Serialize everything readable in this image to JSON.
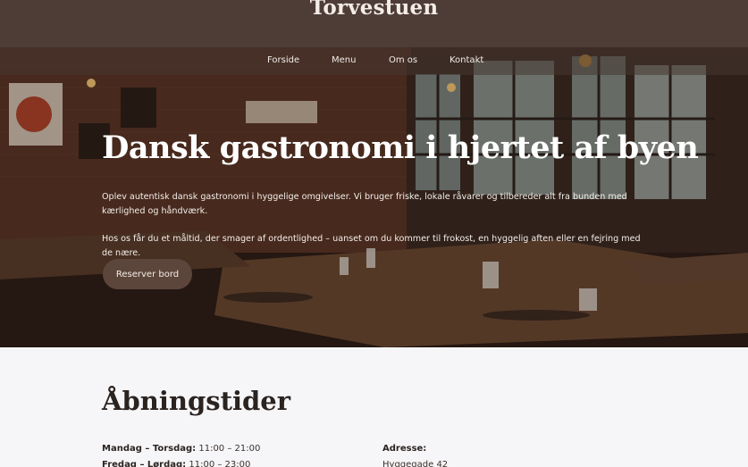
{
  "header": {
    "brand": "Torvestuen"
  },
  "nav": {
    "items": [
      "Forside",
      "Menu",
      "Om os",
      "Kontakt"
    ]
  },
  "hero": {
    "title": "Dansk gastronomi i hjertet af byen",
    "paragraph1": "Oplev autentisk dansk gastronomi i hyggelige omgivelser. Vi bruger friske, lokale råvarer og tilbereder alt fra bunden med kærlighed og håndværk.",
    "paragraph2": "Hos os får du et måltid, der smager af ordentlighed – uanset om du kommer til frokost, en hyggelig aften eller en fejring med de nære.",
    "cta_label": "Reserver bord"
  },
  "hours": {
    "title": "Åbningstider",
    "rows": [
      {
        "days": "Mandag – Torsdag:",
        "time": "11:00 – 21:00"
      },
      {
        "days": "Fredag – Lørdag:",
        "time": "11:00 – 23:00"
      }
    ]
  },
  "address": {
    "label": "Adresse:",
    "street": "Hyggegade 42"
  },
  "colors": {
    "header_bg": "#4d3d36",
    "button_bg": "#5c463b",
    "page_bg": "#f6f6f8"
  }
}
